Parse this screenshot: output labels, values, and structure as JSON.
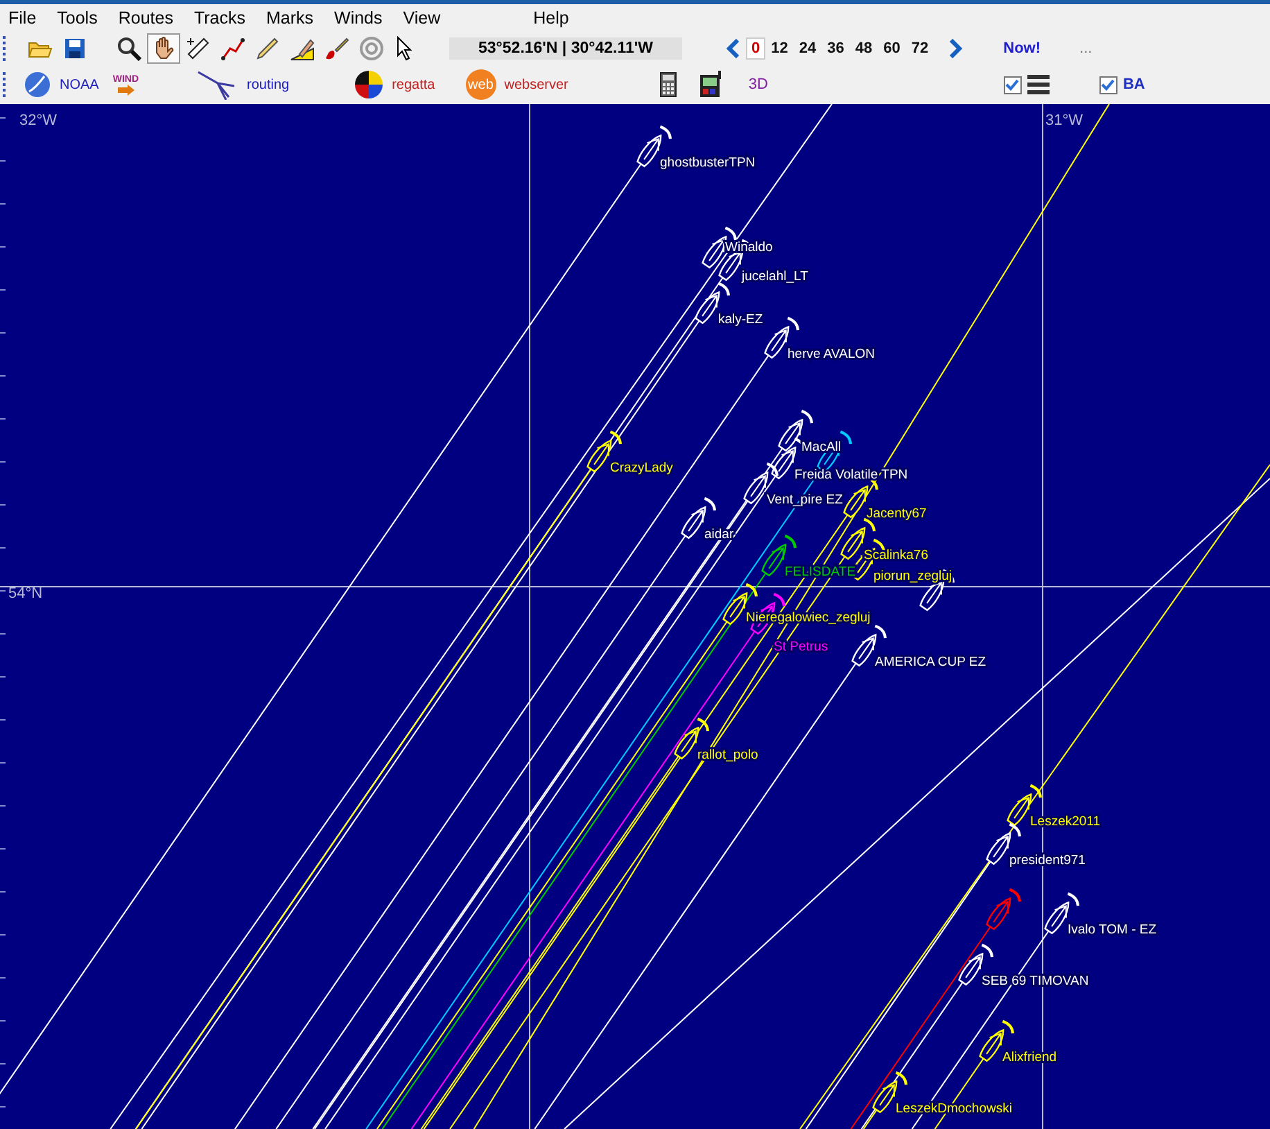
{
  "menu": [
    "File",
    "Tools",
    "Routes",
    "Tracks",
    "Marks",
    "Winds",
    "View",
    "Help"
  ],
  "tools": [
    {
      "kind": "open",
      "selected": false
    },
    {
      "kind": "save",
      "selected": false
    },
    {
      "kind": "zoom",
      "selected": false
    },
    {
      "kind": "hand",
      "selected": true
    },
    {
      "kind": "ruler",
      "selected": false
    },
    {
      "kind": "route",
      "selected": false
    },
    {
      "kind": "pencil",
      "selected": false
    },
    {
      "kind": "mark",
      "selected": false
    },
    {
      "kind": "brush",
      "selected": false
    },
    {
      "kind": "target",
      "selected": false
    },
    {
      "kind": "pointer",
      "selected": false
    }
  ],
  "coordinates": "53°52.16'N | 30°42.11'W",
  "time_steps": [
    {
      "label": "0",
      "selected": true
    },
    {
      "label": "12",
      "selected": false
    },
    {
      "label": "24",
      "selected": false
    },
    {
      "label": "36",
      "selected": false
    },
    {
      "label": "48",
      "selected": false
    },
    {
      "label": "60",
      "selected": false
    },
    {
      "label": "72",
      "selected": false
    }
  ],
  "now": "Now!",
  "more": "...",
  "toolbar2": {
    "noaa": "NOAA",
    "wind_icon": "WIND",
    "routing": "routing",
    "regatta": "regatta",
    "web_icon": "web",
    "webserver": "webserver",
    "three_d": "3D",
    "list_toggle": {
      "checked": true
    },
    "ba": {
      "label": "BA",
      "checked": true
    }
  },
  "map": {
    "grid_labels": [
      "32°W",
      "31°W",
      "54°N"
    ],
    "boats": [
      {
        "name": "ghostbusterTPN",
        "color": "#ffffff"
      },
      {
        "name": "Winaldo",
        "color": "#ffffff"
      },
      {
        "name": "jucelahl_LT",
        "color": "#ffffff"
      },
      {
        "name": "kaly-EZ",
        "color": "#ffffff"
      },
      {
        "name": "herve AVALON",
        "color": "#ffffff"
      },
      {
        "name": "CrazyLady",
        "color": "#ffff00"
      },
      {
        "name": "MacAll",
        "color": "#ffffff"
      },
      {
        "name": "Freida Volatile TPN",
        "color": "#ffffff"
      },
      {
        "color": "#00ccff"
      },
      {
        "name": "Vent_pire EZ",
        "color": "#ffffff"
      },
      {
        "name": "Jacenty67",
        "color": "#ffff00"
      },
      {
        "name": "aidar",
        "color": "#ffffff"
      },
      {
        "name": "Scalinka76",
        "color": "#ffff00"
      },
      {
        "name": "piorun_zegluj",
        "color": "#ffff00"
      },
      {
        "name": "FELISDATE",
        "color": "#00cc00"
      },
      {
        "color": "#ffffff"
      },
      {
        "name": "Nieregalowiec_zegluj",
        "color": "#ffff00"
      },
      {
        "name": "St Petrus",
        "color": "#ff00ff"
      },
      {
        "name": "AMERICA CUP EZ",
        "color": "#ffffff"
      },
      {
        "name": "rallot_polo",
        "color": "#ffff00"
      },
      {
        "name": "Leszek2011",
        "color": "#ffff00"
      },
      {
        "name": "president971",
        "color": "#ffffff"
      },
      {
        "color": "#ff0000"
      },
      {
        "name": "Ivalo TOM - EZ",
        "color": "#ffffff"
      },
      {
        "name": "SEB 69 TIMOVAN",
        "color": "#ffffff"
      },
      {
        "name": "Alixfriend",
        "color": "#ffff00"
      },
      {
        "name": "LeszekDmochowski",
        "color": "#ffff00"
      }
    ]
  }
}
